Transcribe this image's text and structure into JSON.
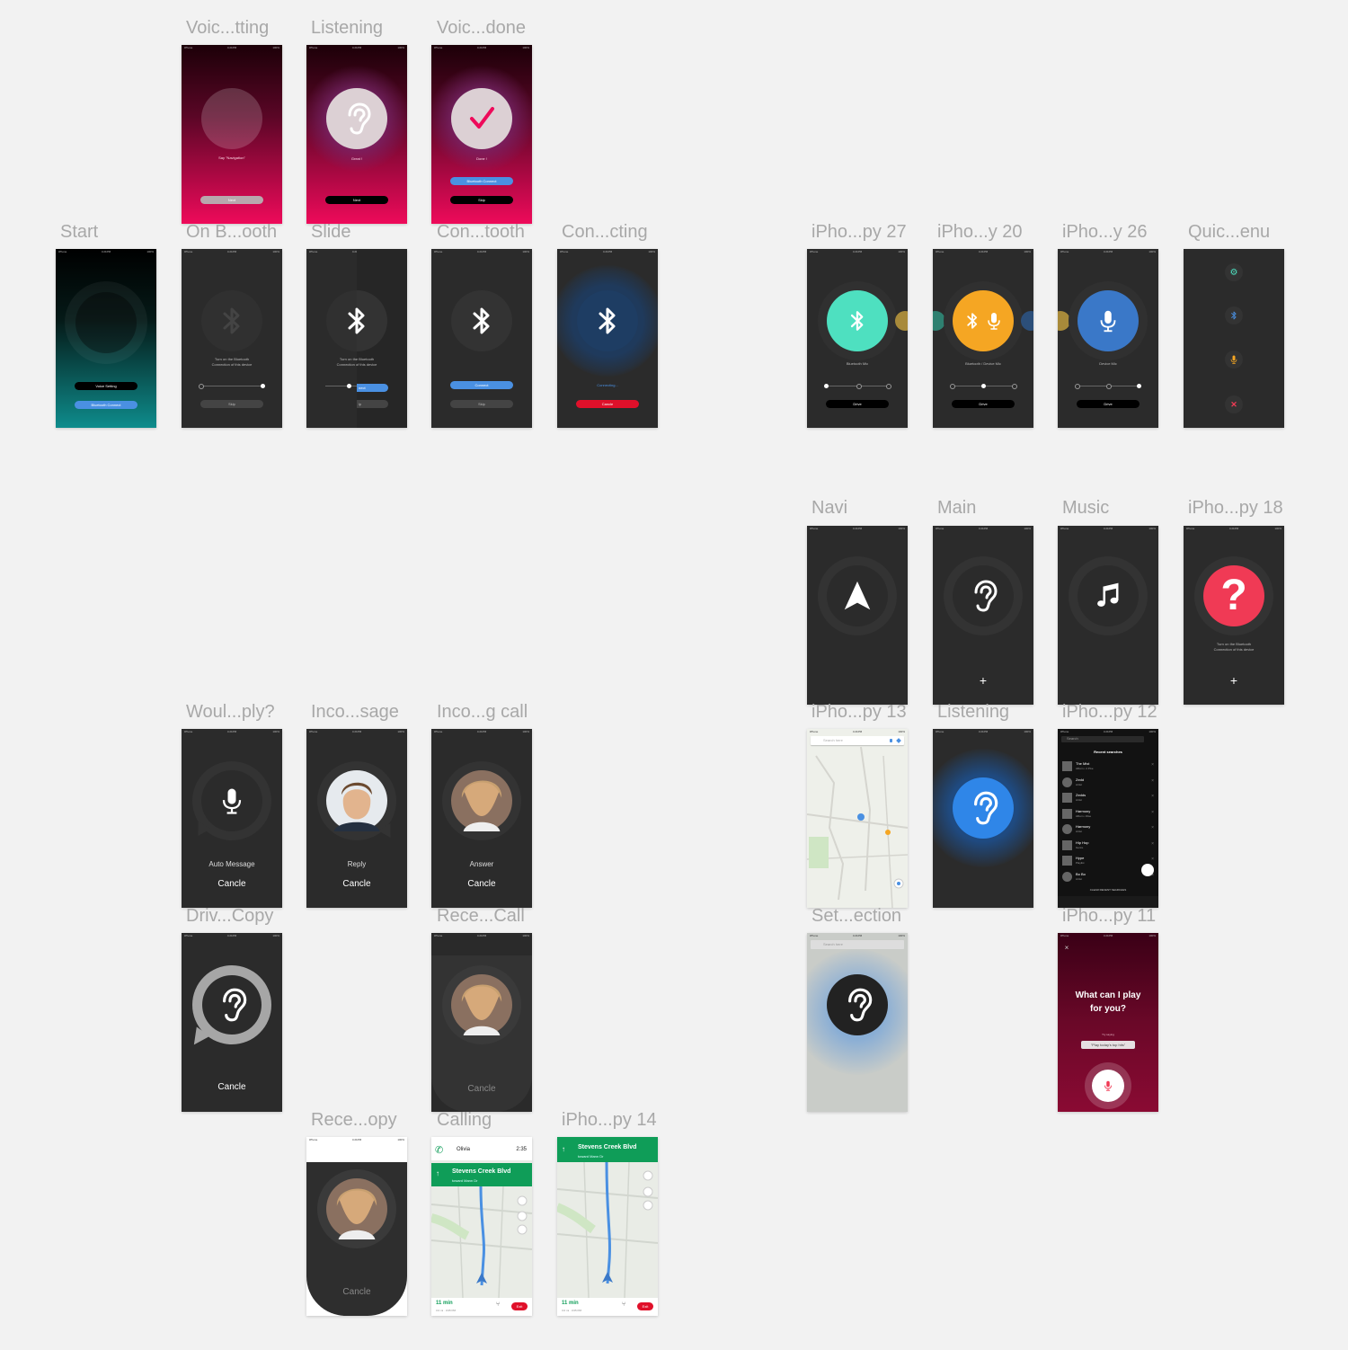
{
  "artboards": {
    "voice_setting": "Voic...tting",
    "listening_top": "Listening",
    "voice_done": "Voic...done",
    "start": "Start",
    "on_bluetooth": "On B...ooth",
    "slide": "Slide",
    "connect_bluetooth": "Con...tooth",
    "connecting": "Con...cting",
    "iphone_27": "iPho...py 27",
    "iphone_20": "iPho...y 20",
    "iphone_26": "iPho...y 26",
    "quick_menu": "Quic...enu",
    "navi": "Navi",
    "main": "Main",
    "music": "Music",
    "iphone_18": "iPho...py 18",
    "would_reply": "Woul...ply?",
    "incoming_message": "Inco...sage",
    "incoming_call": "Inco...g call",
    "iphone_13": "iPho...py 13",
    "listening_mid": "Listening",
    "iphone_12": "iPho...py 12",
    "driving_copy": "Driv...Copy",
    "receive_call": "Rece...Call",
    "set_direction": "Set...ection",
    "iphone_11": "iPho...py 11",
    "receive_copy": "Rece...opy",
    "calling": "Calling",
    "iphone_14": "iPho...py 14"
  },
  "status_bar": {
    "carrier": "iPhone",
    "time": "4:21PM",
    "battery": "100%"
  },
  "screens": {
    "voice_setting": {
      "hint": "Say \"Navigation\"",
      "button": "Next"
    },
    "listening_top": {
      "hint": "Great !",
      "button": "Next"
    },
    "voice_done": {
      "hint": "Done !",
      "button_primary": "Bluetooth Connect",
      "button_secondary": "Skip"
    },
    "start": {
      "button_primary": "Voice Setting",
      "button_secondary": "Bluetooth Connect"
    },
    "on_bluetooth": {
      "hint_line1": "Turn on the Bluetooth",
      "hint_line2": "Connection of this device",
      "button": "Skip"
    },
    "slide": {
      "hint_line1": "Turn on the Bluetooth",
      "hint_line2": "Connection of this device",
      "button_partial": "nect",
      "skip_partial": "ip"
    },
    "connect_bluetooth": {
      "button_primary": "Connect",
      "button_secondary": "Skip"
    },
    "connecting": {
      "status": "Connecting...",
      "button": "Cancle"
    },
    "iphone_27": {
      "label": "Bluetooth Mic",
      "button": "Drive"
    },
    "iphone_20": {
      "label": "Bluetooth / Device Mic",
      "button": "Drive"
    },
    "iphone_26": {
      "label": "Device Mic",
      "button": "Drive"
    },
    "iphone_18": {
      "hint_line1": "Turn on the Bluetooth",
      "hint_line2": "Connection of this device"
    },
    "would_reply": {
      "label": "Auto Message",
      "cancel": "Cancle"
    },
    "incoming_message": {
      "label": "Reply",
      "cancel": "Cancle"
    },
    "incoming_call": {
      "label": "Answer",
      "cancel": "Cancle"
    },
    "iphone_13": {
      "search_placeholder": "Search here"
    },
    "iphone_12": {
      "search": "Search",
      "title": "Recent searches",
      "items": [
        {
          "title": "The Mist",
          "sub": "Album • 4 Pixe"
        },
        {
          "title": "Zedd",
          "sub": "Artist"
        },
        {
          "title": "Zedds",
          "sub": "Artist"
        },
        {
          "title": "Harmony",
          "sub": "Album • Rise"
        },
        {
          "title": "Harmony",
          "sub": "Artist"
        },
        {
          "title": "Hip Hop",
          "sub": "Genre"
        },
        {
          "title": "Hype",
          "sub": "Playlist"
        },
        {
          "title": "Bo Bo",
          "sub": "Artist"
        }
      ],
      "clear": "CLEAR RECENT SEARCHES"
    },
    "driving_copy": {
      "cancel": "Cancle"
    },
    "receive_call": {
      "cancel": "Cancle"
    },
    "set_direction": {
      "search_placeholder": "Search here"
    },
    "iphone_11": {
      "question_line1": "What can I play",
      "question_line2": "for you?",
      "try_label": "Try saying",
      "suggestion": "\"Play today's top hits\""
    },
    "receive_copy": {
      "cancel": "Cancle"
    },
    "calling": {
      "contact": "Olivia",
      "duration": "2:35",
      "street": "Stevens Creek Blvd",
      "toward": "toward Mann Dr",
      "eta": "11 min",
      "eta_sub": "3.0 mi · 3:05 PM",
      "exit": "Exit"
    },
    "iphone_14": {
      "street": "Stevens Creek Blvd",
      "toward": "toward Mann Dr",
      "eta": "11 min",
      "eta_sub": "3.0 mi · 3:05 PM",
      "exit": "Exit"
    }
  },
  "colors": {
    "canvas": "#f2f2f2",
    "screen_dark": "#2b2b2b",
    "pink": "#ee0a5a",
    "bluetooth_blue": "#4a90e2",
    "teal": "#4ee0c0",
    "orange": "#f5a623",
    "red": "#f03a55",
    "cancel_red": "#e0102a",
    "nav_green": "#0f9d58"
  },
  "icons": [
    "ear-icon",
    "check-icon",
    "bluetooth-icon",
    "microphone-icon",
    "navigation-arrow-icon",
    "music-note-icon",
    "question-icon",
    "plus-icon",
    "settings-icon",
    "close-icon",
    "phone-icon"
  ]
}
